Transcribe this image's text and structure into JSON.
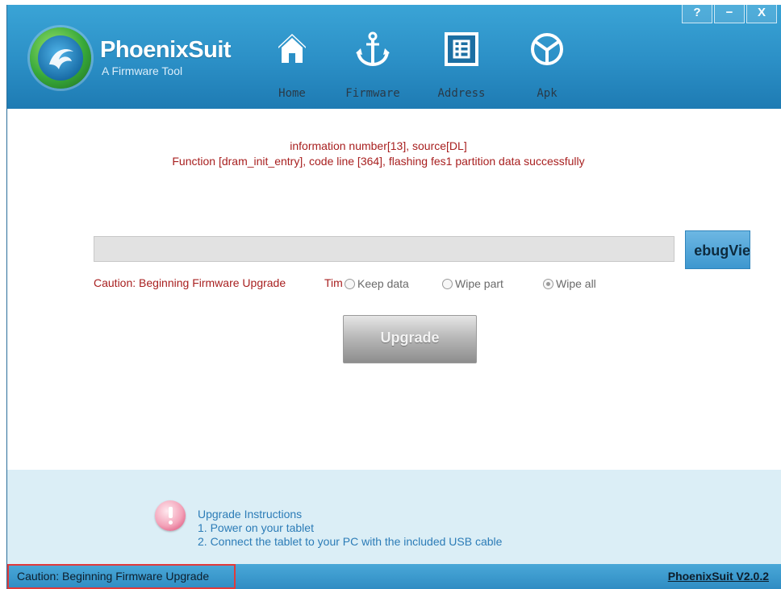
{
  "header": {
    "app_title": "PhoenixSuit",
    "app_subtitle": "A Firmware Tool",
    "nav": [
      {
        "label": "Home",
        "icon": "home-icon"
      },
      {
        "label": "Firmware",
        "icon": "anchor-icon"
      },
      {
        "label": "Address",
        "icon": "grid-icon"
      },
      {
        "label": "Apk",
        "icon": "android-icon"
      }
    ],
    "window_buttons": {
      "help": "?",
      "minimize": "−",
      "close": "X"
    }
  },
  "main": {
    "status_message": "information number[13], source[DL]\nFunction [dram_init_entry], code line [364], flashing fes1 partition data successfully",
    "progress_percent": 0,
    "debug_button_label": "ebugVie",
    "caution_text": "Caution: Beginning Firmware Upgrade",
    "time_label": "Tim",
    "options": [
      {
        "label": "Keep data",
        "selected": false
      },
      {
        "label": "Wipe part",
        "selected": false
      },
      {
        "label": "Wipe all",
        "selected": true
      }
    ],
    "upgrade_label": "Upgrade"
  },
  "instructions": {
    "title": "Upgrade Instructions",
    "lines": [
      "1. Power on your tablet",
      "2. Connect the tablet to your PC with the included USB cable"
    ]
  },
  "statusbar": {
    "left_text": "Caution: Beginning Firmware Upgrade",
    "version_text": "PhoenixSuit V2.0.2"
  },
  "colors": {
    "header_blue": "#2b8fc6",
    "message_red": "#a82020",
    "info_panel": "#dbeef6",
    "statusbar_blue": "#3a9bd0",
    "highlight_border": "#e03a3a"
  }
}
